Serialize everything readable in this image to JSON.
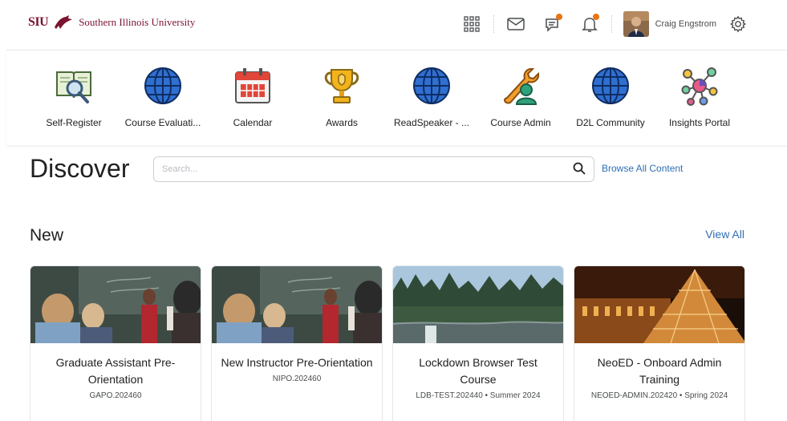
{
  "header": {
    "brand_abbr": "SIU",
    "brand_name": "Southern Illinois University",
    "user_name": "Craig Engstrom",
    "icons": [
      "apps-grid-icon",
      "mail-icon",
      "chat-icon",
      "bell-icon",
      "gear-icon"
    ],
    "notification_color": "#e87511"
  },
  "quick_links": [
    {
      "label": "Self-Register",
      "icon": "book-magnifier-icon"
    },
    {
      "label": "Course Evaluati...",
      "icon": "globe-icon"
    },
    {
      "label": "Calendar",
      "icon": "calendar-icon"
    },
    {
      "label": "Awards",
      "icon": "trophy-icon"
    },
    {
      "label": "ReadSpeaker - ...",
      "icon": "globe-icon"
    },
    {
      "label": "Course Admin",
      "icon": "wrench-user-icon"
    },
    {
      "label": "D2L Community",
      "icon": "globe-icon"
    },
    {
      "label": "Insights Portal",
      "icon": "network-icon"
    }
  ],
  "discover": {
    "title": "Discover",
    "search_placeholder": "Search...",
    "browse_label": "Browse All Content"
  },
  "new_section": {
    "title": "New",
    "view_all": "View All"
  },
  "cards": [
    {
      "title": "Graduate Assistant Pre-Orientation",
      "meta": "GAPO.202460",
      "image": "classroom"
    },
    {
      "title": "New Instructor Pre-Orientation",
      "meta": "NIPO.202460",
      "image": "classroom"
    },
    {
      "title": "Lockdown Browser Test Course",
      "meta": "LDB-TEST.202440 • Summer 2024",
      "image": "forest-lake"
    },
    {
      "title": "NeoED - Onboard Admin Training",
      "meta": "NEOED-ADMIN.202420 • Spring 2024",
      "image": "louvre-night"
    }
  ],
  "colors": {
    "link": "#2f6fb5",
    "brand": "#7a1430",
    "accent": "#e87511"
  }
}
